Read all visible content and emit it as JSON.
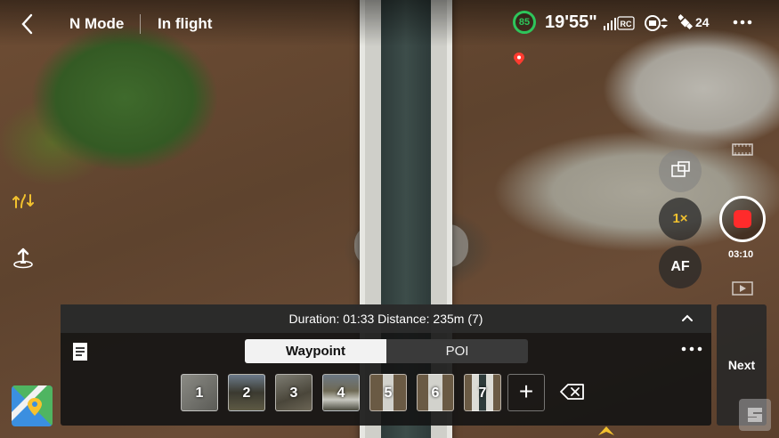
{
  "topbar": {
    "back_icon": "chevron-left-icon",
    "mode": "N Mode",
    "status": "In flight",
    "battery_percent": "85",
    "battery_level": 0.85,
    "flight_time": "19'55\"",
    "signal_label": "RC",
    "satellites": "24",
    "colors": {
      "battery": "#2ec55b"
    }
  },
  "camera": {
    "zoom": "1×",
    "focus": "AF",
    "record_time": "03:10",
    "colors": {
      "record": "#ff2b2b",
      "zoom": "#f2c12e"
    }
  },
  "panel": {
    "summary": "Duration: 01:33 Distance: 235m (7)",
    "tabs": [
      "Waypoint",
      "POI"
    ],
    "active_tab": "Waypoint",
    "waypoints": [
      "1",
      "2",
      "3",
      "4",
      "5",
      "6",
      "7"
    ],
    "add_label": "+",
    "next_label": "Next"
  }
}
